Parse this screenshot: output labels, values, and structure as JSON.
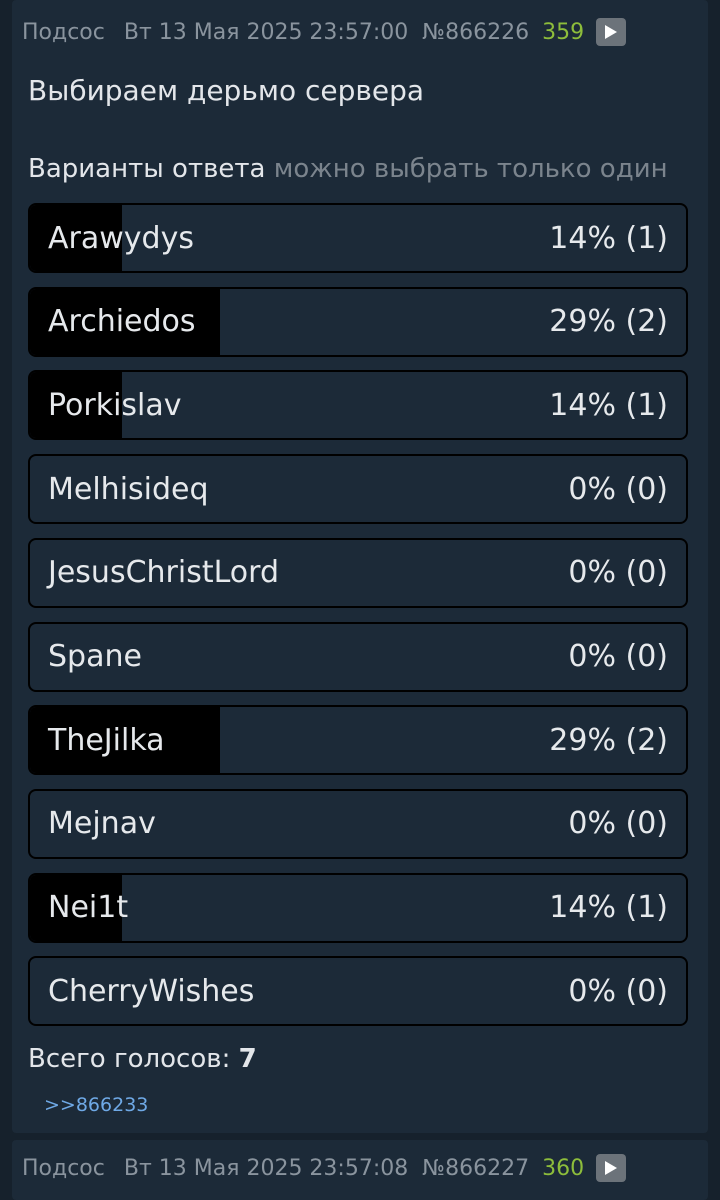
{
  "post": {
    "author": "Подсос",
    "date": "Вт 13 Мая 2025 23:57:00",
    "number": "№866226",
    "count": "359",
    "title": "Выбираем дерьмо сервера",
    "poll_label": "Варианты ответа",
    "poll_hint": "можно выбрать только один",
    "options": [
      {
        "name": "Arawydys",
        "result": "14% (1)",
        "percent": 14
      },
      {
        "name": "Archiedos",
        "result": "29% (2)",
        "percent": 29
      },
      {
        "name": "Porkislav",
        "result": "14% (1)",
        "percent": 14
      },
      {
        "name": "Melhisideq",
        "result": "0% (0)",
        "percent": 0
      },
      {
        "name": "JesusChristLord",
        "result": "0% (0)",
        "percent": 0
      },
      {
        "name": "Spane",
        "result": "0% (0)",
        "percent": 0
      },
      {
        "name": "TheJilka",
        "result": "29% (2)",
        "percent": 29
      },
      {
        "name": "Mejnav",
        "result": "0% (0)",
        "percent": 0
      },
      {
        "name": "Nei1t",
        "result": "14% (1)",
        "percent": 14
      },
      {
        "name": "CherryWishes",
        "result": "0% (0)",
        "percent": 0
      }
    ],
    "total_label": "Всего голосов:",
    "total_value": "7",
    "reply_link": ">>866233"
  },
  "next_post": {
    "author": "Подсос",
    "date": "Вт 13 Мая 2025 23:57:08",
    "number": "№866227",
    "count": "360"
  },
  "colors": {
    "page_bg": "#16212c",
    "card_bg": "#1c2a38",
    "bar_fill": "#000000",
    "count_green": "#8dbd3b",
    "link_blue": "#6fa9e6"
  }
}
